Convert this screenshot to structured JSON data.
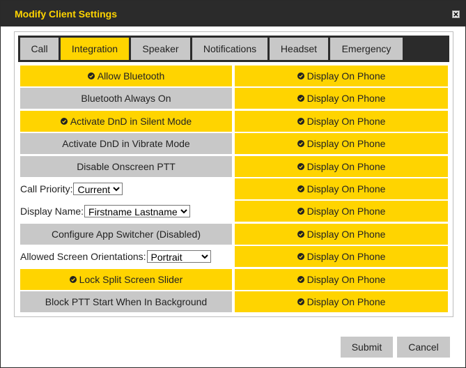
{
  "dialog": {
    "title": "Modify Client Settings"
  },
  "tabs": [
    {
      "label": "Call",
      "active": false
    },
    {
      "label": "Integration",
      "active": true
    },
    {
      "label": "Speaker",
      "active": false
    },
    {
      "label": "Notifications",
      "active": false
    },
    {
      "label": "Headset",
      "active": false
    },
    {
      "label": "Emergency",
      "active": false
    }
  ],
  "settings": [
    {
      "label": "Allow Bluetooth",
      "checked": true
    },
    {
      "label": "Bluetooth Always On",
      "checked": false
    },
    {
      "label": "Activate DnD in Silent Mode",
      "checked": true
    },
    {
      "label": "Activate DnD in Vibrate Mode",
      "checked": false
    },
    {
      "label": "Disable Onscreen PTT",
      "checked": false
    },
    {
      "label": "Call Priority:",
      "select_value": "Current"
    },
    {
      "label": "Display Name:",
      "select_value": "Firstname Lastname"
    },
    {
      "label": "Configure App Switcher (Disabled)",
      "checked": false
    },
    {
      "label": "Allowed Screen Orientations:",
      "select_value": "Portrait"
    },
    {
      "label": "Lock Split Screen Slider",
      "checked": true
    },
    {
      "label": "Block PTT Start When In Background",
      "checked": false
    }
  ],
  "display_on_phone": [
    {
      "label": "Display On Phone",
      "checked": true
    },
    {
      "label": "Display On Phone",
      "checked": true
    },
    {
      "label": "Display On Phone",
      "checked": true
    },
    {
      "label": "Display On Phone",
      "checked": true
    },
    {
      "label": "Display On Phone",
      "checked": true
    },
    {
      "label": "Display On Phone",
      "checked": true
    },
    {
      "label": "Display On Phone",
      "checked": true
    },
    {
      "label": "Display On Phone",
      "checked": true
    },
    {
      "label": "Display On Phone",
      "checked": true
    },
    {
      "label": "Display On Phone",
      "checked": true
    },
    {
      "label": "Display On Phone",
      "checked": true
    }
  ],
  "buttons": {
    "submit": "Submit",
    "cancel": "Cancel"
  },
  "colors": {
    "accent": "#ffd400",
    "inactive": "#c8c8c8",
    "bar": "#2b2b2b"
  },
  "icons": {
    "close": "close-icon",
    "check": "check-icon"
  }
}
